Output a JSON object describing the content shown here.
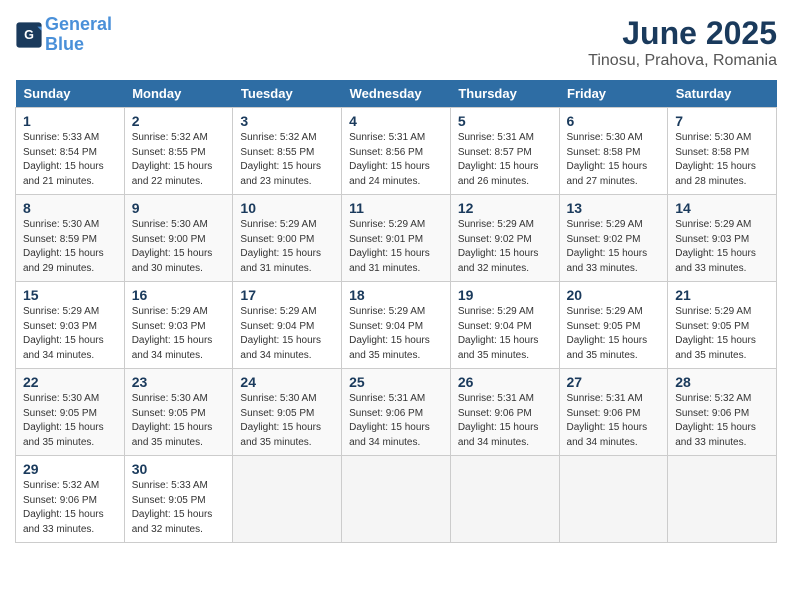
{
  "logo": {
    "line1": "General",
    "line2": "Blue"
  },
  "title": "June 2025",
  "location": "Tinosu, Prahova, Romania",
  "headers": [
    "Sunday",
    "Monday",
    "Tuesday",
    "Wednesday",
    "Thursday",
    "Friday",
    "Saturday"
  ],
  "weeks": [
    [
      {
        "day": "1",
        "info": "Sunrise: 5:33 AM\nSunset: 8:54 PM\nDaylight: 15 hours\nand 21 minutes."
      },
      {
        "day": "2",
        "info": "Sunrise: 5:32 AM\nSunset: 8:55 PM\nDaylight: 15 hours\nand 22 minutes."
      },
      {
        "day": "3",
        "info": "Sunrise: 5:32 AM\nSunset: 8:55 PM\nDaylight: 15 hours\nand 23 minutes."
      },
      {
        "day": "4",
        "info": "Sunrise: 5:31 AM\nSunset: 8:56 PM\nDaylight: 15 hours\nand 24 minutes."
      },
      {
        "day": "5",
        "info": "Sunrise: 5:31 AM\nSunset: 8:57 PM\nDaylight: 15 hours\nand 26 minutes."
      },
      {
        "day": "6",
        "info": "Sunrise: 5:30 AM\nSunset: 8:58 PM\nDaylight: 15 hours\nand 27 minutes."
      },
      {
        "day": "7",
        "info": "Sunrise: 5:30 AM\nSunset: 8:58 PM\nDaylight: 15 hours\nand 28 minutes."
      }
    ],
    [
      {
        "day": "8",
        "info": "Sunrise: 5:30 AM\nSunset: 8:59 PM\nDaylight: 15 hours\nand 29 minutes."
      },
      {
        "day": "9",
        "info": "Sunrise: 5:30 AM\nSunset: 9:00 PM\nDaylight: 15 hours\nand 30 minutes."
      },
      {
        "day": "10",
        "info": "Sunrise: 5:29 AM\nSunset: 9:00 PM\nDaylight: 15 hours\nand 31 minutes."
      },
      {
        "day": "11",
        "info": "Sunrise: 5:29 AM\nSunset: 9:01 PM\nDaylight: 15 hours\nand 31 minutes."
      },
      {
        "day": "12",
        "info": "Sunrise: 5:29 AM\nSunset: 9:02 PM\nDaylight: 15 hours\nand 32 minutes."
      },
      {
        "day": "13",
        "info": "Sunrise: 5:29 AM\nSunset: 9:02 PM\nDaylight: 15 hours\nand 33 minutes."
      },
      {
        "day": "14",
        "info": "Sunrise: 5:29 AM\nSunset: 9:03 PM\nDaylight: 15 hours\nand 33 minutes."
      }
    ],
    [
      {
        "day": "15",
        "info": "Sunrise: 5:29 AM\nSunset: 9:03 PM\nDaylight: 15 hours\nand 34 minutes."
      },
      {
        "day": "16",
        "info": "Sunrise: 5:29 AM\nSunset: 9:03 PM\nDaylight: 15 hours\nand 34 minutes."
      },
      {
        "day": "17",
        "info": "Sunrise: 5:29 AM\nSunset: 9:04 PM\nDaylight: 15 hours\nand 34 minutes."
      },
      {
        "day": "18",
        "info": "Sunrise: 5:29 AM\nSunset: 9:04 PM\nDaylight: 15 hours\nand 35 minutes."
      },
      {
        "day": "19",
        "info": "Sunrise: 5:29 AM\nSunset: 9:04 PM\nDaylight: 15 hours\nand 35 minutes."
      },
      {
        "day": "20",
        "info": "Sunrise: 5:29 AM\nSunset: 9:05 PM\nDaylight: 15 hours\nand 35 minutes."
      },
      {
        "day": "21",
        "info": "Sunrise: 5:29 AM\nSunset: 9:05 PM\nDaylight: 15 hours\nand 35 minutes."
      }
    ],
    [
      {
        "day": "22",
        "info": "Sunrise: 5:30 AM\nSunset: 9:05 PM\nDaylight: 15 hours\nand 35 minutes."
      },
      {
        "day": "23",
        "info": "Sunrise: 5:30 AM\nSunset: 9:05 PM\nDaylight: 15 hours\nand 35 minutes."
      },
      {
        "day": "24",
        "info": "Sunrise: 5:30 AM\nSunset: 9:05 PM\nDaylight: 15 hours\nand 35 minutes."
      },
      {
        "day": "25",
        "info": "Sunrise: 5:31 AM\nSunset: 9:06 PM\nDaylight: 15 hours\nand 34 minutes."
      },
      {
        "day": "26",
        "info": "Sunrise: 5:31 AM\nSunset: 9:06 PM\nDaylight: 15 hours\nand 34 minutes."
      },
      {
        "day": "27",
        "info": "Sunrise: 5:31 AM\nSunset: 9:06 PM\nDaylight: 15 hours\nand 34 minutes."
      },
      {
        "day": "28",
        "info": "Sunrise: 5:32 AM\nSunset: 9:06 PM\nDaylight: 15 hours\nand 33 minutes."
      }
    ],
    [
      {
        "day": "29",
        "info": "Sunrise: 5:32 AM\nSunset: 9:06 PM\nDaylight: 15 hours\nand 33 minutes."
      },
      {
        "day": "30",
        "info": "Sunrise: 5:33 AM\nSunset: 9:05 PM\nDaylight: 15 hours\nand 32 minutes."
      },
      {
        "day": "",
        "info": ""
      },
      {
        "day": "",
        "info": ""
      },
      {
        "day": "",
        "info": ""
      },
      {
        "day": "",
        "info": ""
      },
      {
        "day": "",
        "info": ""
      }
    ]
  ]
}
